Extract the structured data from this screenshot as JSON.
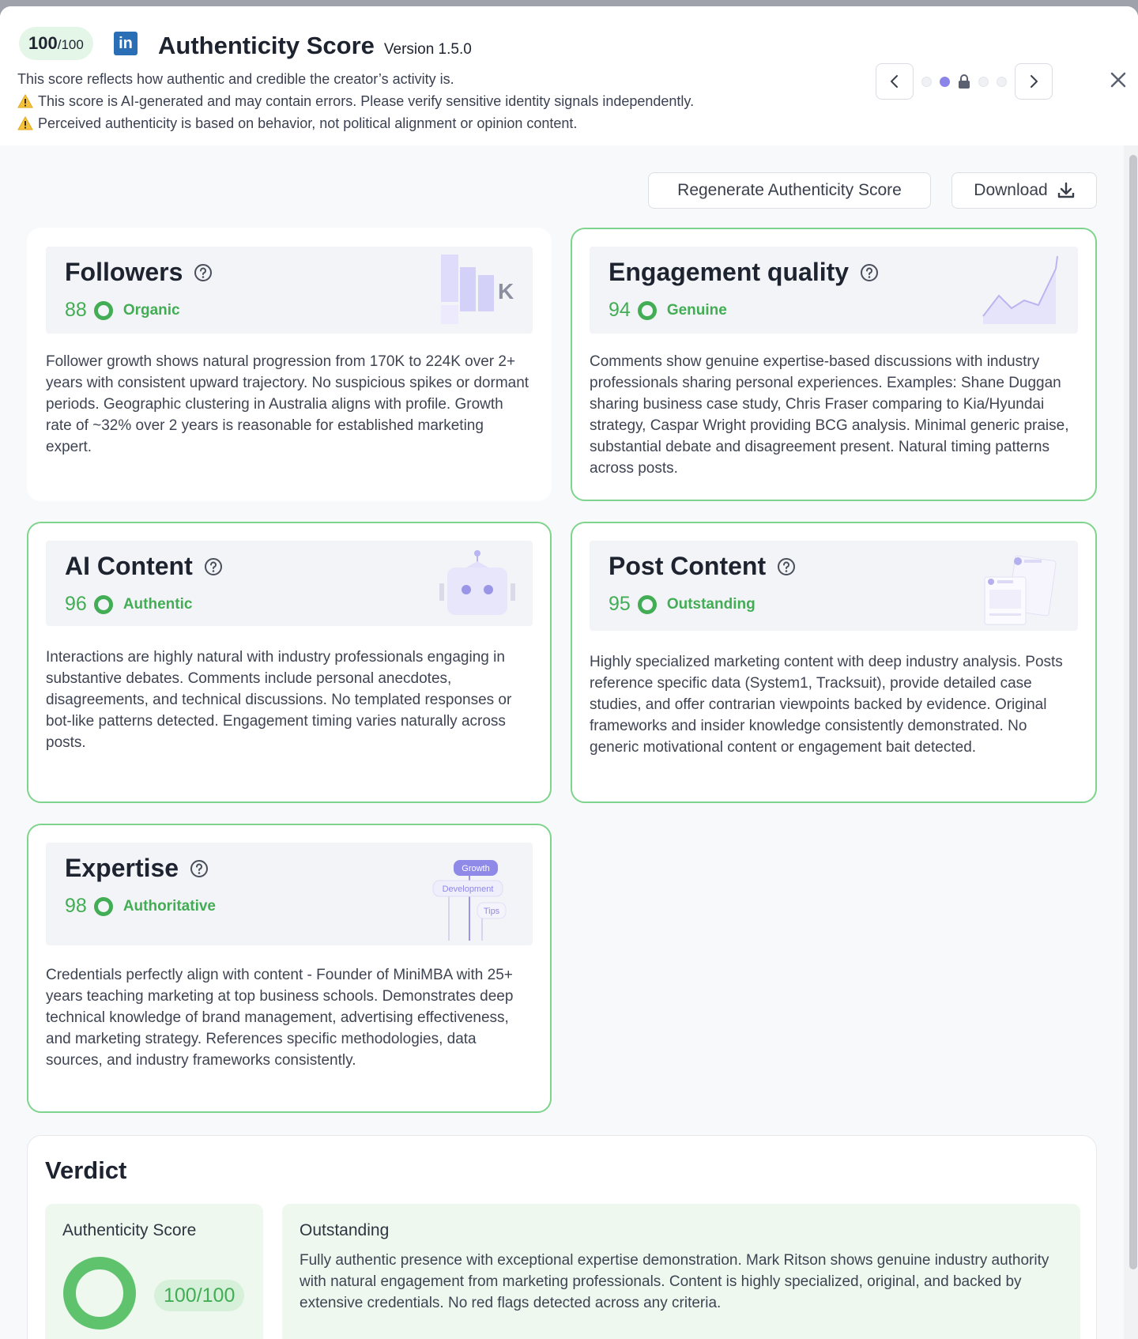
{
  "header": {
    "score_value": "100",
    "score_max": "/100",
    "platform_icon": "linkedin-icon",
    "title": "Authenticity Score",
    "version": "Version 1.5.0",
    "lines": [
      "This score reflects how authentic and credible the creator’s activity is.",
      "This score is AI-generated and may contain errors. Please verify sensitive identity signals independently.",
      "Perceived authenticity is based on behavior, not political alignment or opinion content."
    ]
  },
  "actions": {
    "regenerate_label": "Regenerate Authenticity Score",
    "download_label": "Download"
  },
  "cards": [
    {
      "title": "Followers",
      "score": "88",
      "label": "Organic",
      "illustration_text": "K",
      "body": "Follower growth shows natural progression from 170K to 224K over 2+ years with consistent upward trajectory. No suspicious spikes or dormant periods. Geographic clustering in Australia aligns with profile. Growth rate of ~32% over 2 years is reasonable for established marketing expert."
    },
    {
      "title": "Engagement quality",
      "score": "94",
      "label": "Genuine",
      "body": "Comments show genuine expertise-based discussions with industry professionals sharing personal experiences. Examples: Shane Duggan sharing business case study, Chris Fraser comparing to Kia/Hyundai strategy, Caspar Wright providing BCG analysis. Minimal generic praise, substantial debate and disagreement present. Natural timing patterns across posts."
    },
    {
      "title": "AI Content",
      "score": "96",
      "label": "Authentic",
      "body": "Interactions are highly natural with industry professionals engaging in substantive debates. Comments include personal anecdotes, disagreements, and technical discussions. No templated responses or bot-like patterns detected. Engagement timing varies naturally across posts."
    },
    {
      "title": "Post Content",
      "score": "95",
      "label": "Outstanding",
      "body": "Highly specialized marketing content with deep industry analysis. Posts reference specific data (System1, Tracksuit), provide detailed case studies, and offer contrarian viewpoints backed by evidence. Original frameworks and insider knowledge consistently demonstrated. No generic motivational content or engagement bait detected."
    },
    {
      "title": "Expertise",
      "score": "98",
      "label": "Authoritative",
      "tags": [
        "Growth",
        "Development",
        "Tips"
      ],
      "body": "Credentials perfectly align with content - Founder of MiniMBA with 25+ years teaching marketing at top business schools. Demonstrates deep technical knowledge of brand management, advertising effectiveness, and marketing strategy. References specific methodologies, data sources, and industry frameworks consistently."
    }
  ],
  "verdict": {
    "title": "Verdict",
    "score_label": "Authenticity Score",
    "score": "100/100",
    "heading": "Outstanding",
    "text": "Fully authentic presence with exceptional expertise demonstration. Mark Ritson shows genuine industry authority with natural engagement from marketing professionals. Content is highly specialized, original, and backed by extensive credentials. No red flags detected across any criteria."
  },
  "colors": {
    "accent_green": "#43ad55",
    "border_green": "#7ed48c",
    "accent_purple": "#8b85ea",
    "linkedin_blue": "#2a6fb6"
  }
}
